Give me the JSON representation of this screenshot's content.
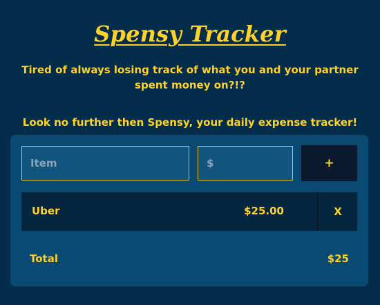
{
  "header": {
    "title": "Spensy Tracker",
    "tagline": "Tired of always losing track of what you and your partner spent money on?!?",
    "tagline_2": "Look no further then Spensy, your daily expense tracker!"
  },
  "form": {
    "item_placeholder": "Item",
    "item_value": "",
    "amount_placeholder": "$",
    "amount_value": "",
    "add_label": "+"
  },
  "expenses": [
    {
      "name": "Uber",
      "amount": "$25.00",
      "delete_label": "X"
    }
  ],
  "summary": {
    "total_label": "Total",
    "total_value": "$25"
  },
  "colors": {
    "background": "#042d4b",
    "card": "#0a4a72",
    "accent": "#ffd12a",
    "row": "#06263f",
    "button": "#0c1a2f"
  }
}
